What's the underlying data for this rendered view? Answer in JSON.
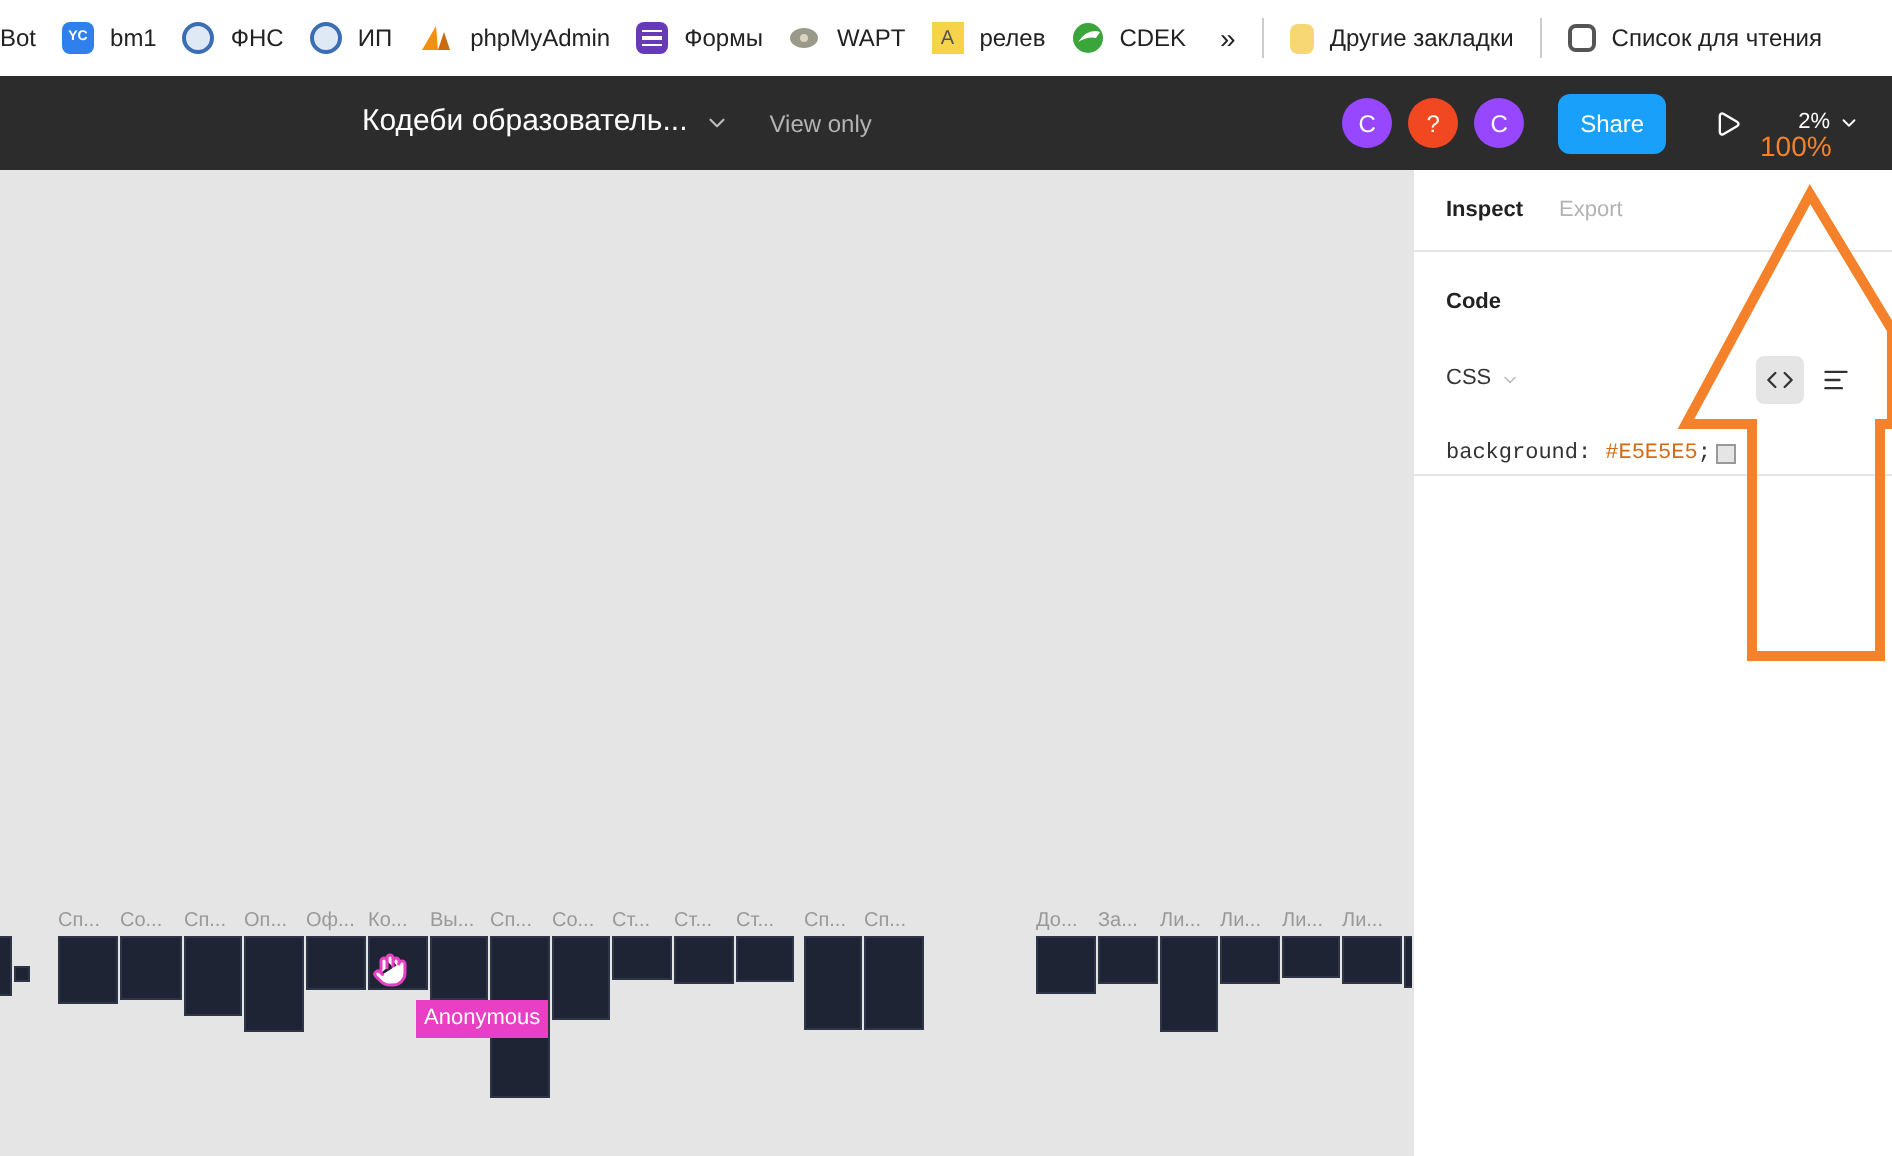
{
  "bookmarks": [
    {
      "label": "Bot",
      "kind": "plain"
    },
    {
      "label": "bm1",
      "kind": "yc",
      "icon_text": "YC"
    },
    {
      "label": "ФНС",
      "kind": "emblem"
    },
    {
      "label": "ИП",
      "kind": "emblem"
    },
    {
      "label": "phpMyAdmin",
      "kind": "pma"
    },
    {
      "label": "Формы",
      "kind": "forms"
    },
    {
      "label": "WAPT",
      "kind": "wapt"
    },
    {
      "label": "релев",
      "kind": "letter",
      "icon_text": "A"
    },
    {
      "label": "CDEK",
      "kind": "cdek"
    }
  ],
  "bookmarks_more": "»",
  "other_bookmarks": "Другие закладки",
  "reading_list": "Список для чтения",
  "toolbar": {
    "file_name": "Кодеби образователь...",
    "mode": "View only",
    "avatars": [
      {
        "letter": "C",
        "color": "#9747ff"
      },
      {
        "letter": "?",
        "color": "#f24822"
      },
      {
        "letter": "C",
        "color": "#9747ff"
      }
    ],
    "share": "Share",
    "zoom": "2%"
  },
  "canvas": {
    "frames": [
      {
        "label": "Сп..."
      },
      {
        "label": "Со..."
      },
      {
        "label": "Сп..."
      },
      {
        "label": "Оп..."
      },
      {
        "label": "Оф..."
      },
      {
        "label": "Ко..."
      },
      {
        "label": "Вы..."
      },
      {
        "label": "Сп..."
      },
      {
        "label": "Со..."
      },
      {
        "label": "Ст..."
      },
      {
        "label": "Ст..."
      },
      {
        "label": "Ст..."
      },
      {
        "label": "Сп..."
      },
      {
        "label": "Сп..."
      },
      {
        "label": "До..."
      },
      {
        "label": "За..."
      },
      {
        "label": "Ли..."
      },
      {
        "label": "Ли..."
      },
      {
        "label": "Ли..."
      },
      {
        "label": "Ли..."
      }
    ],
    "cursor_label": "Anonymous"
  },
  "panel": {
    "tabs": [
      {
        "label": "Inspect",
        "selected": true
      },
      {
        "label": "Export",
        "selected": false
      }
    ],
    "section": "Code",
    "language": "CSS",
    "code_property": "background:",
    "code_value": "#E5E5E5",
    "code_end": ";"
  },
  "annotation": "100%"
}
